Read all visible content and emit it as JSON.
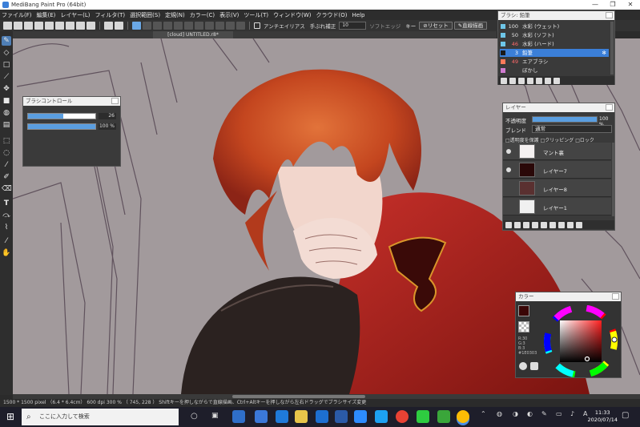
{
  "window": {
    "title": "MediBang Paint Pro (64bit)",
    "minimize": "—",
    "maximize": "❐",
    "close": "✕"
  },
  "menu": [
    "ファイル(F)",
    "編集(E)",
    "レイヤー(L)",
    "フィルタ(T)",
    "選択範囲(S)",
    "定規(N)",
    "カラー(C)",
    "表示(V)",
    "ツール(T)",
    "ウィンドウ(W)",
    "クラウド(O)",
    "Help"
  ],
  "toolbar": {
    "antialias_label": "アンチエイリアス",
    "stabilizer_label": "手ぶれ補正",
    "stabilizer_value": "10",
    "soft_edge_label": "ソフトエッジ",
    "key_label": "キー",
    "reset_label": "リセット",
    "straight_line_label": "直線描画"
  },
  "document_tab": "[cloud] UNTITLED.r8*",
  "brush_control": {
    "title": "ブラシコントロール",
    "size": 26,
    "size_label": "26",
    "opacity": 100,
    "opacity_label": "100 %"
  },
  "brush_panel": {
    "title": "ブラシ: 鉛筆",
    "items": [
      {
        "size": "100",
        "name": "水彩 (ウェット)",
        "color": "#6ec6e8"
      },
      {
        "size": "50",
        "name": "水彩 (ソフト)",
        "color": "#6ec6e8"
      },
      {
        "size": "46",
        "name": "水彩 (ハード)",
        "color": "#6ec6e8"
      },
      {
        "size": "3",
        "name": "鉛筆",
        "color": "#1a1a1a"
      },
      {
        "size": "49",
        "name": "エアブラシ",
        "color": "#ff7a5a"
      },
      {
        "size": "",
        "name": "ぼかし",
        "color": "#d07bd0"
      }
    ],
    "selected_index": 3,
    "gear_icon": "gear-icon"
  },
  "layer_panel": {
    "title": "レイヤー",
    "opacity_label": "不透明度",
    "opacity_value": "100 %",
    "opacity": 100,
    "blend_label": "ブレンド",
    "blend_value": "通常",
    "protect_alpha": "透明度を保護",
    "clipping": "クリッピング",
    "lock": "ロック",
    "layers": [
      {
        "name": "マント裏",
        "thumb": "#f4f0f0"
      },
      {
        "name": "レイヤー7",
        "thumb": "#2a0808"
      },
      {
        "name": "レイヤー8",
        "thumb": "#5a3030"
      },
      {
        "name": "レイヤー1",
        "thumb": "#f0f0f0"
      }
    ]
  },
  "color_panel": {
    "title": "カラー",
    "current_color": "#3a0606",
    "r": "R:30",
    "g": "G:3",
    "b": "B:3",
    "hex": "#1E0303"
  },
  "status": {
    "text": "1500 * 1500 pixel （6.4 * 6.4cm） 600 dpi   300 %   （ 745, 228 ）  Shiftキーを押しながらで直線描画、Ctrl+Altキーを押しながら左右ドラッグでブラシサイズ変更"
  },
  "taskbar": {
    "search_placeholder": "ここに入力して検索",
    "time": "11:33",
    "date": "2020/07/14",
    "ime": "A"
  }
}
